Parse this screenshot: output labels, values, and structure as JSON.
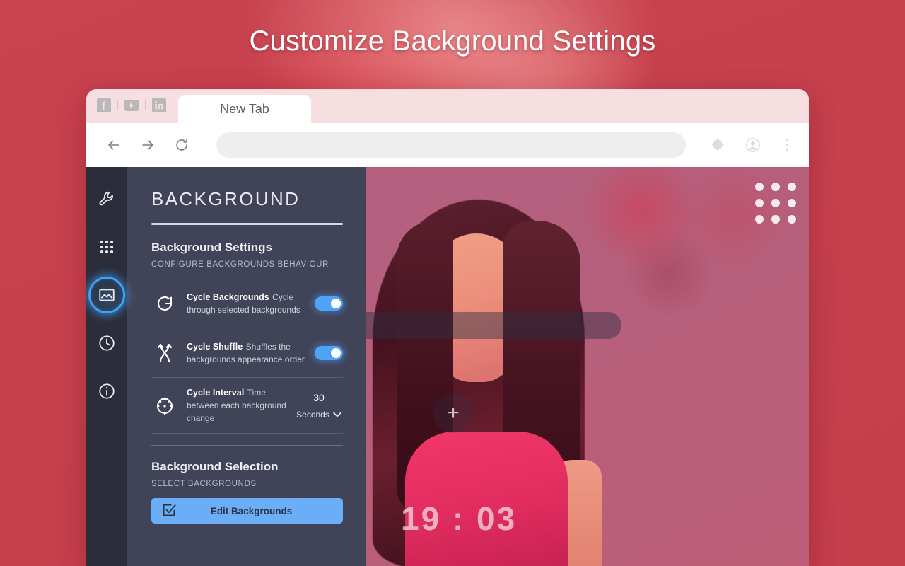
{
  "promo": {
    "title": "Customize Background Settings"
  },
  "browser": {
    "quick_links": [
      {
        "name": "facebook-icon",
        "label": "Facebook"
      },
      {
        "name": "youtube-icon",
        "label": "YouTube"
      },
      {
        "name": "linkedin-icon",
        "label": "LinkedIn"
      }
    ],
    "tab": {
      "title": "New Tab"
    },
    "toolbar": {
      "back": "Back",
      "forward": "Forward",
      "reload": "Reload",
      "omnibox_value": "",
      "omnibox_placeholder": "",
      "extensions": "Extensions",
      "profile": "Profile",
      "menu": "Customize and control"
    }
  },
  "extension": {
    "rail": [
      {
        "name": "wrench-icon",
        "label": "General",
        "active": false
      },
      {
        "name": "grid-icon",
        "label": "Apps",
        "active": false
      },
      {
        "name": "image-icon",
        "label": "Background",
        "active": true
      },
      {
        "name": "clock-icon",
        "label": "Time",
        "active": false
      },
      {
        "name": "info-icon",
        "label": "About",
        "active": false
      }
    ],
    "panel": {
      "title": "BACKGROUND",
      "sections": [
        {
          "heading": "Background Settings",
          "subheading": "CONFIGURE BACKGROUNDS BEHAVIOUR",
          "rows": [
            {
              "icon": "cycle-icon",
              "title": "Cycle Backgrounds",
              "description": "Cycle through selected backgrounds",
              "control": "toggle",
              "value": "on"
            },
            {
              "icon": "shuffle-icon",
              "title": "Cycle Shuffle",
              "description": "Shuffles the backgrounds appearance order",
              "control": "toggle",
              "value": "on"
            },
            {
              "icon": "timer-icon",
              "title": "Cycle Interval",
              "description": "Time between each background change",
              "control": "number-with-unit",
              "value": "30",
              "unit": "Seconds"
            }
          ]
        },
        {
          "heading": "Background Selection",
          "subheading": "SELECT BACKGROUNDS",
          "button": {
            "icon": "checkbox-checked-icon",
            "label": "Edit Backgrounds"
          }
        }
      ]
    },
    "newtab": {
      "clock": "19 : 03",
      "search_placeholder": "",
      "add_shortcut_label": "+",
      "apps_grid_label": "Apps"
    }
  },
  "colors": {
    "promo_background": "#c8424f",
    "panel_background": "#414459",
    "rail_background": "#2b2d3a",
    "accent_blue": "#4da3f7",
    "button_blue": "#6aaef8",
    "tabstrip_pink": "#f7dfe1"
  }
}
